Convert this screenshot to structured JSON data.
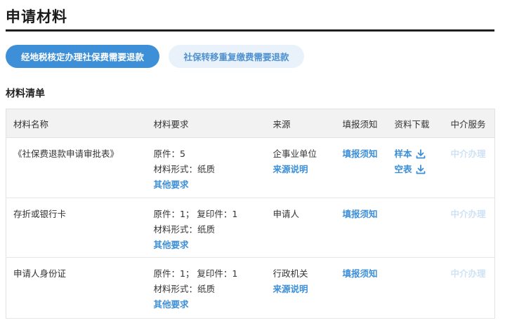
{
  "page_title": "申请材料",
  "tabs": [
    {
      "label": "经地税核定办理社保费需要退款",
      "active": true
    },
    {
      "label": "社保转移重复缴费需要退款",
      "active": false
    }
  ],
  "section_title": "材料清单",
  "table": {
    "headers": [
      "材料名称",
      "材料要求",
      "来源",
      "填报须知",
      "资料下载",
      "中介服务"
    ],
    "rows": [
      {
        "name": "《社保费退款申请审批表》",
        "req_line1": "原件：5",
        "req_line2": "材料形式：纸质",
        "req_more": "其他要求",
        "source": "企事业单位",
        "source_note": "来源说明",
        "notice": "填报须知",
        "download_sample": "样本",
        "download_blank": "空表",
        "agency": "中介办理"
      },
      {
        "name": "存折或银行卡",
        "req_line1": "原件：1； 复印件：1",
        "req_line2": "材料形式：纸质",
        "req_more": "其他要求",
        "source": "申请人",
        "notice": "填报须知",
        "agency": "中介办理"
      },
      {
        "name": "申请人身份证",
        "req_line1": "原件：1； 复印件：1",
        "req_line2": "材料形式：纸质",
        "req_more": "其他要求",
        "source": "行政机关",
        "source_note": "来源说明",
        "notice": "填报须知",
        "agency": "中介办理"
      }
    ]
  },
  "colors": {
    "accent": "#3d8fd8",
    "tab_inactive_bg": "#e9f2fb",
    "disabled_link": "#cfe2f4"
  },
  "icons": {
    "download": "download-icon"
  }
}
